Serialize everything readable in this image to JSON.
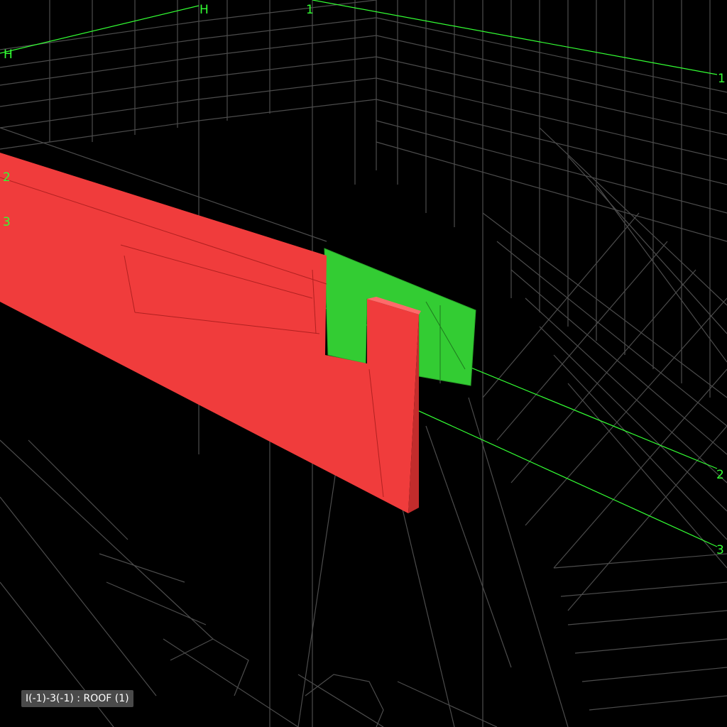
{
  "viewer": {
    "background": "#000000",
    "wireframe_color": "#5a5a5a"
  },
  "grid_lines": {
    "color": "#33ff33",
    "labels": [
      {
        "id": "H",
        "text": "H"
      },
      {
        "id": "1",
        "text": "1"
      },
      {
        "id": "2",
        "text": "2"
      },
      {
        "id": "3",
        "text": "3"
      }
    ]
  },
  "elements": {
    "selected_beam": {
      "color": "#f03c3c"
    },
    "highlighted_plate": {
      "color": "#33cc33"
    }
  },
  "status": {
    "text": "I(-1)-3(-1) : ROOF (1)"
  }
}
